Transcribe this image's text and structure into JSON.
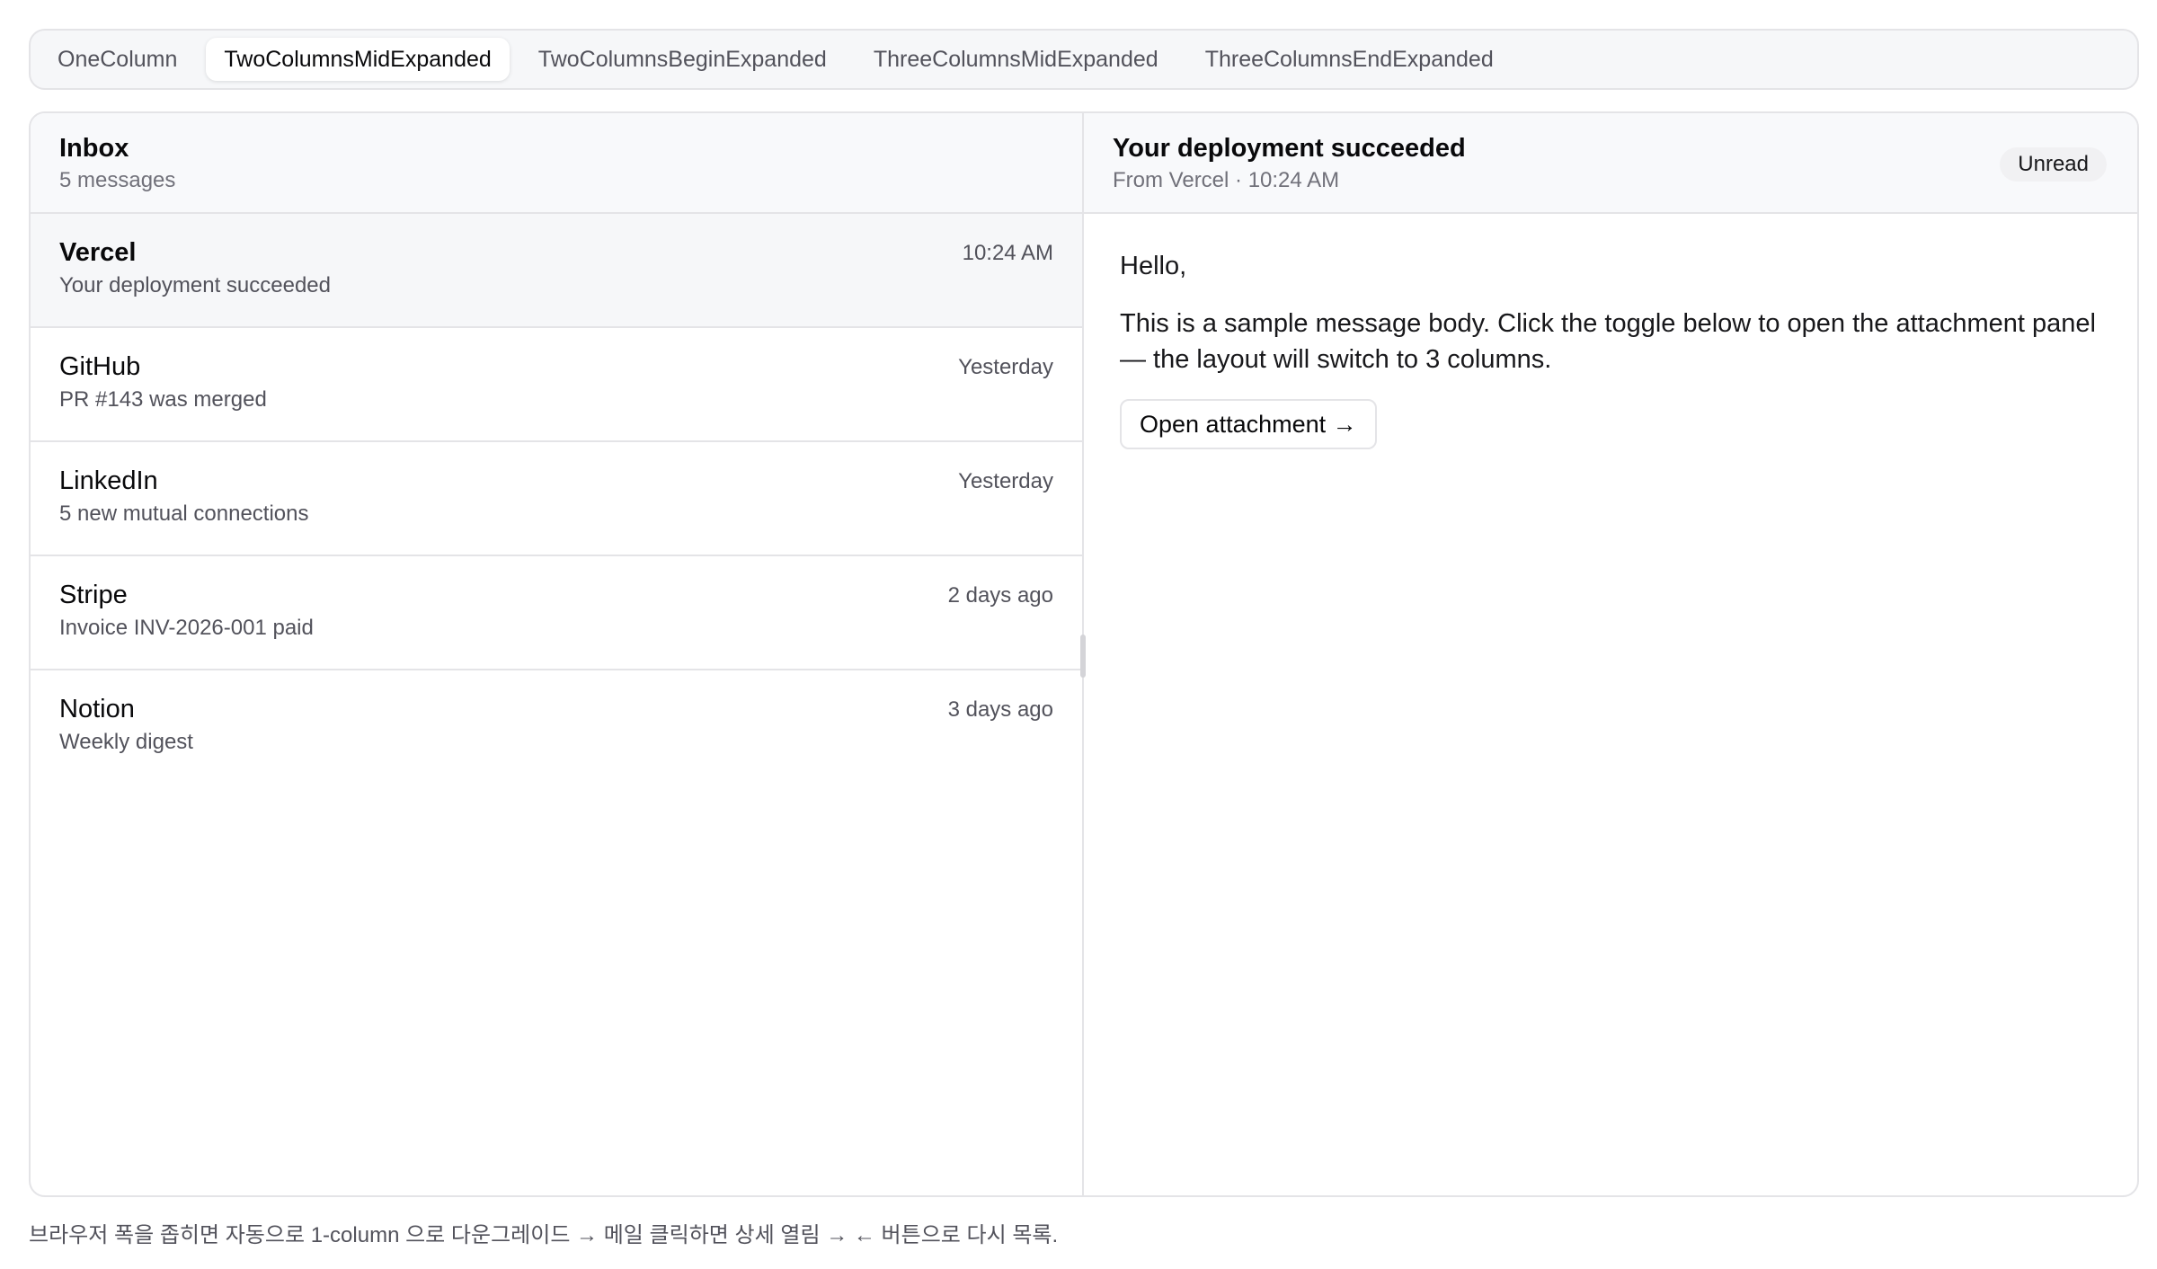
{
  "tabs": [
    {
      "label": "OneColumn"
    },
    {
      "label": "TwoColumnsMidExpanded"
    },
    {
      "label": "TwoColumnsBeginExpanded"
    },
    {
      "label": "ThreeColumnsMidExpanded"
    },
    {
      "label": "ThreeColumnsEndExpanded"
    }
  ],
  "active_tab": "TwoColumnsMidExpanded",
  "inbox": {
    "title": "Inbox",
    "count": "5 messages",
    "messages": [
      {
        "sender": "Vercel",
        "subject": "Your deployment succeeded",
        "time": "10:24 AM"
      },
      {
        "sender": "GitHub",
        "subject": "PR #143 was merged",
        "time": "Yesterday"
      },
      {
        "sender": "LinkedIn",
        "subject": "5 new mutual connections",
        "time": "Yesterday"
      },
      {
        "sender": "Stripe",
        "subject": "Invoice INV-2026-001 paid",
        "time": "2 days ago"
      },
      {
        "sender": "Notion",
        "subject": "Weekly digest",
        "time": "3 days ago"
      }
    ]
  },
  "detail": {
    "title": "Your deployment succeeded",
    "meta": "From Vercel · 10:24 AM",
    "badge": "Unread",
    "greeting": "Hello,",
    "body": "This is a sample message body. Click the toggle below to open the attachment panel — the layout will switch to 3 columns.",
    "attach_label": "Open attachment →"
  },
  "footnote": "브라우저 폭을 좁히면 자동으로 1-column 으로 다운그레이드 → 메일 클릭하면 상세 열림 → ← 버튼으로 다시 목록."
}
